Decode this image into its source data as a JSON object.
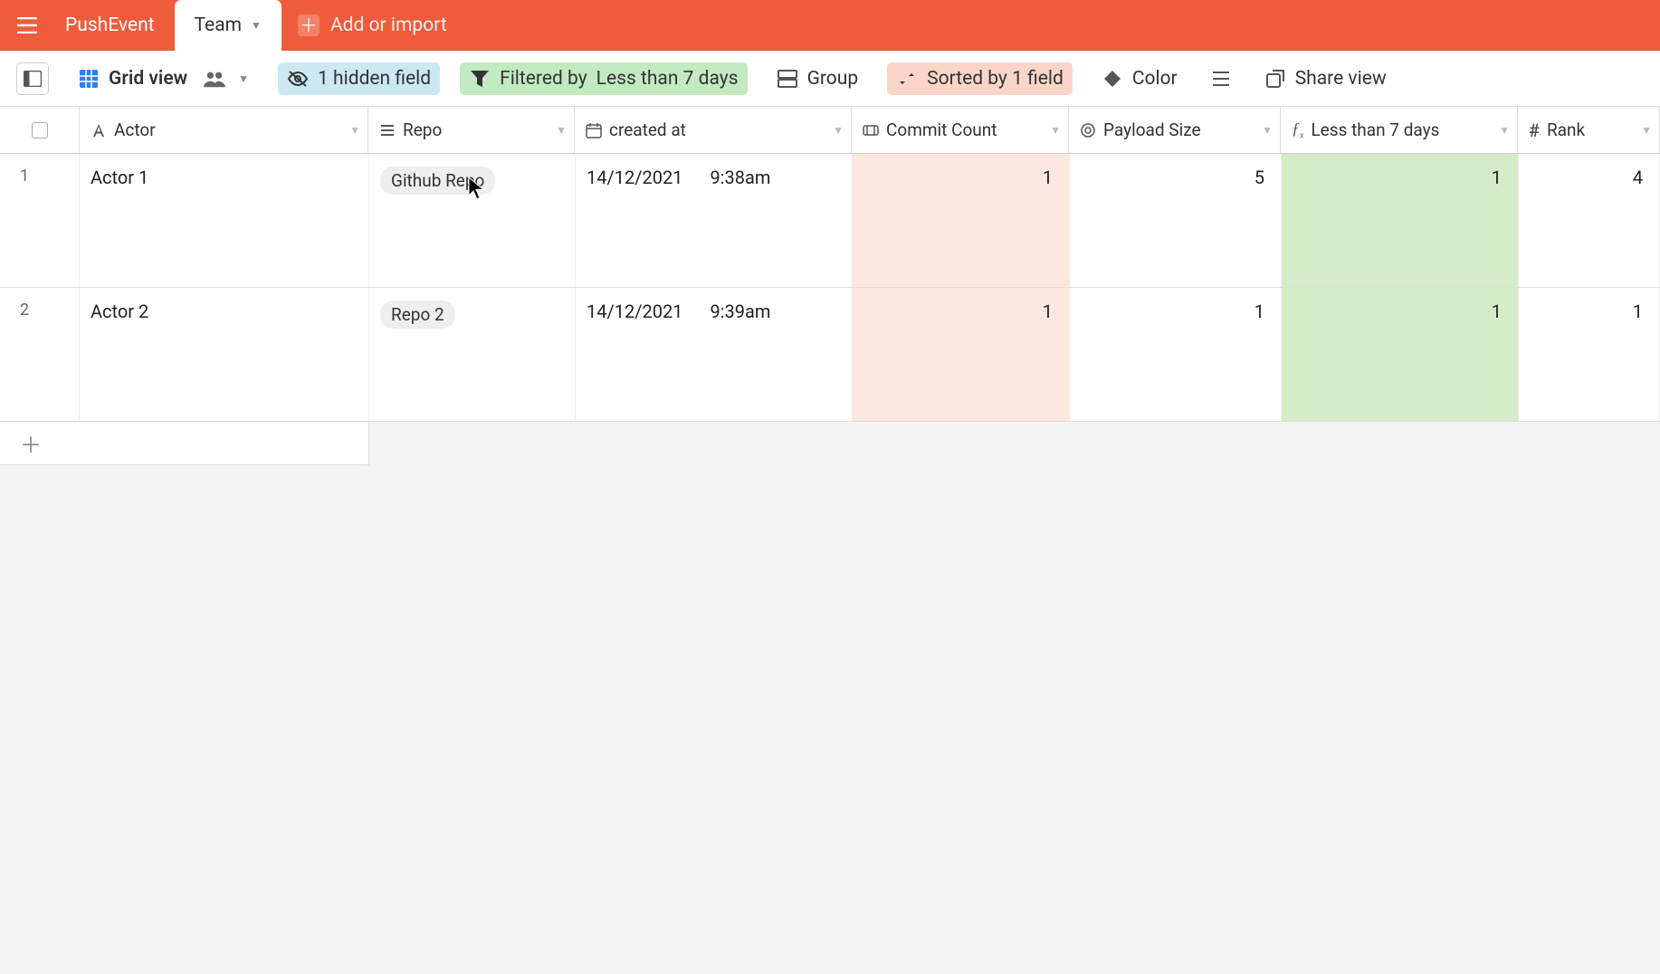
{
  "topbar": {
    "tabs": [
      {
        "label": "PushEvent",
        "active": false
      },
      {
        "label": "Team",
        "active": true
      }
    ],
    "add_import": "Add or import"
  },
  "toolbar": {
    "view_label": "Grid view",
    "hidden_field": "1 hidden field",
    "filtered_prefix": "Filtered by ",
    "filtered_field": "Less than 7 days",
    "group": "Group",
    "sorted": "Sorted by 1 field",
    "color": "Color",
    "share": "Share view"
  },
  "columns": {
    "actor": "Actor",
    "repo": "Repo",
    "created_at": "created at",
    "commit_count": "Commit Count",
    "payload_size": "Payload Size",
    "less7": "Less than 7 days",
    "rank": "Rank"
  },
  "rows": [
    {
      "num": "1",
      "actor": "Actor 1",
      "repo": "Github Repo",
      "date": "14/12/2021",
      "time": "9:38am",
      "commit": "1",
      "payload": "5",
      "less7": "1",
      "rank": "4"
    },
    {
      "num": "2",
      "actor": "Actor 2",
      "repo": "Repo 2",
      "date": "14/12/2021",
      "time": "9:39am",
      "commit": "1",
      "payload": "1",
      "less7": "1",
      "rank": "1"
    }
  ]
}
